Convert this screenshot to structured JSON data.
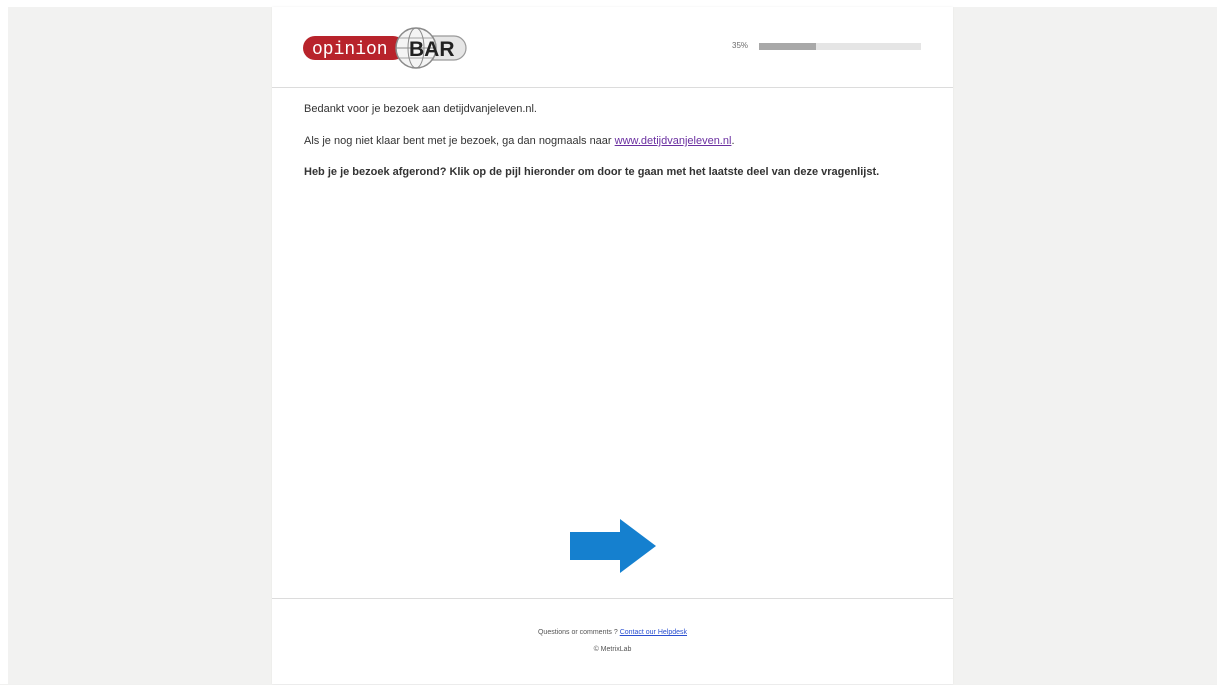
{
  "header": {
    "logo": {
      "text_left": "opinion",
      "text_right": "BAR",
      "brand_red": "#b8232b",
      "brand_gray": "#d8d8d8"
    },
    "progress": {
      "label": "35%",
      "fraction": 0.35
    }
  },
  "main": {
    "line1": "Bedankt voor je bezoek aan detijdvanjeleven.nl.",
    "line2_before": "Als je nog niet klaar bent met je bezoek, ga dan nogmaals naar ",
    "line2_link": "www.detijdvanjeleven.nl",
    "line2_after": ".",
    "line3": "Heb je je bezoek afgerond? Klik op de pijl hieronder om door te gaan met het laatste deel van deze vragenlijst.",
    "next_arrow_color": "#1580cf"
  },
  "footer": {
    "question_text": "Questions or comments ? ",
    "helpdesk_link": "Contact our Helpdesk",
    "copyright": "© MetrixLab"
  }
}
